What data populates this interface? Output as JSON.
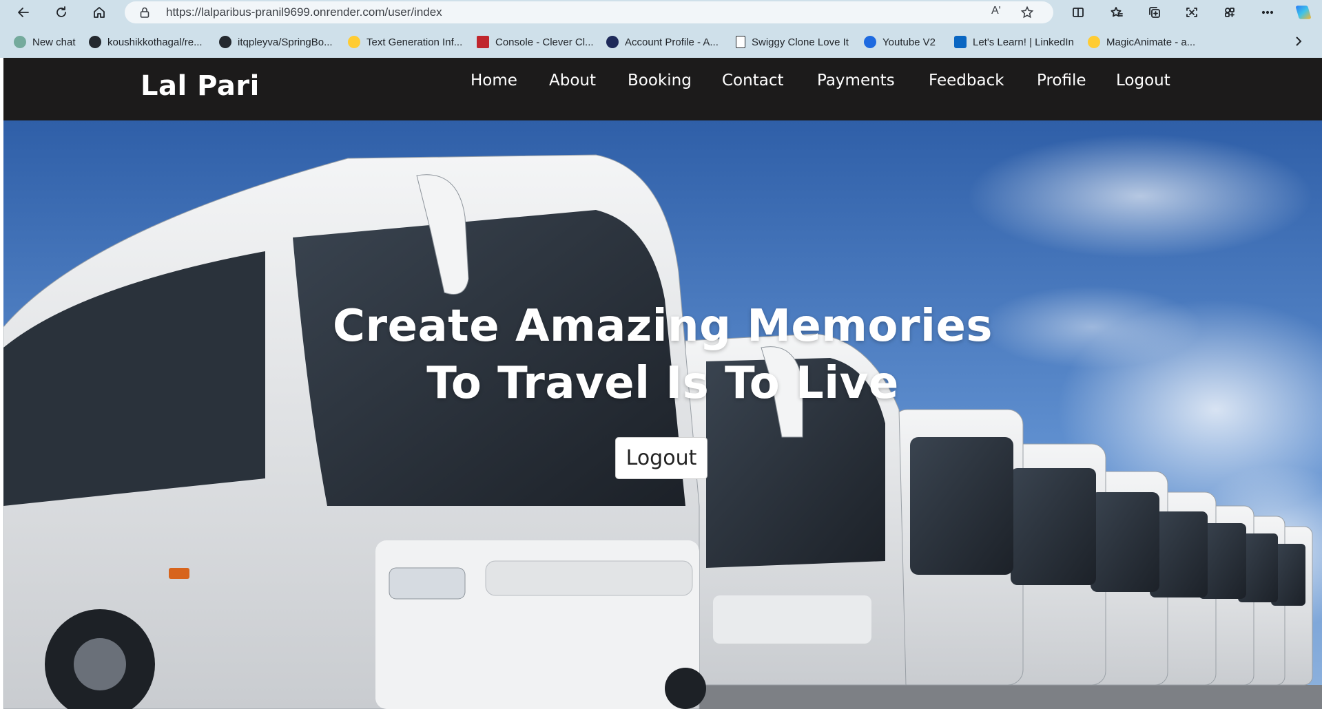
{
  "browser": {
    "url": "https://lalparibus-pranil9699.onrender.com/user/index",
    "read_aloud_label": "Aʹ",
    "toolbar_icons": [
      "back-arrow-icon",
      "refresh-icon",
      "home-icon",
      "lock-icon",
      "read-aloud-icon",
      "favorite-star-icon",
      "split-screen-icon",
      "favorites-icon",
      "collections-icon",
      "screenshot-icon",
      "extensions-icon",
      "more-icon",
      "copilot-icon"
    ],
    "bookmarks": [
      {
        "label": "New chat",
        "icon": "openai-icon",
        "color": "#74aa9c"
      },
      {
        "label": "koushikkothagal/re...",
        "icon": "github-icon",
        "color": "#24292f"
      },
      {
        "label": "itqpleyva/SpringBo...",
        "icon": "github-icon",
        "color": "#24292f"
      },
      {
        "label": "Text Generation Inf...",
        "icon": "huggingface-icon",
        "color": "#ffcc33"
      },
      {
        "label": "Console - Clever Cl...",
        "icon": "clever-cloud-icon",
        "color": "#c0262d"
      },
      {
        "label": "Account Profile - A...",
        "icon": "account-icon",
        "color": "#1e2a5a"
      },
      {
        "label": "Swiggy Clone Love It",
        "icon": "page-icon",
        "color": "#ffffff"
      },
      {
        "label": "Youtube V2",
        "icon": "pin-icon",
        "color": "#1e6ae0"
      },
      {
        "label": "Let's Learn! | LinkedIn",
        "icon": "linkedin-icon",
        "color": "#0a66c2"
      },
      {
        "label": "MagicAnimate - a...",
        "icon": "huggingface-icon",
        "color": "#ffcc33"
      }
    ]
  },
  "site": {
    "brand": "Lal Pari",
    "nav": [
      "Home",
      "About",
      "Booking",
      "Contact",
      "Payments",
      "Feedback",
      "Profile",
      "Logout"
    ],
    "hero": {
      "line1": "Create Amazing Memories",
      "line2": "To Travel Is To Live",
      "button": "Logout"
    }
  },
  "colors": {
    "chrome": "#cfe0ea",
    "navbar": "#1c1b1b",
    "sky": "#3f6fb8"
  }
}
